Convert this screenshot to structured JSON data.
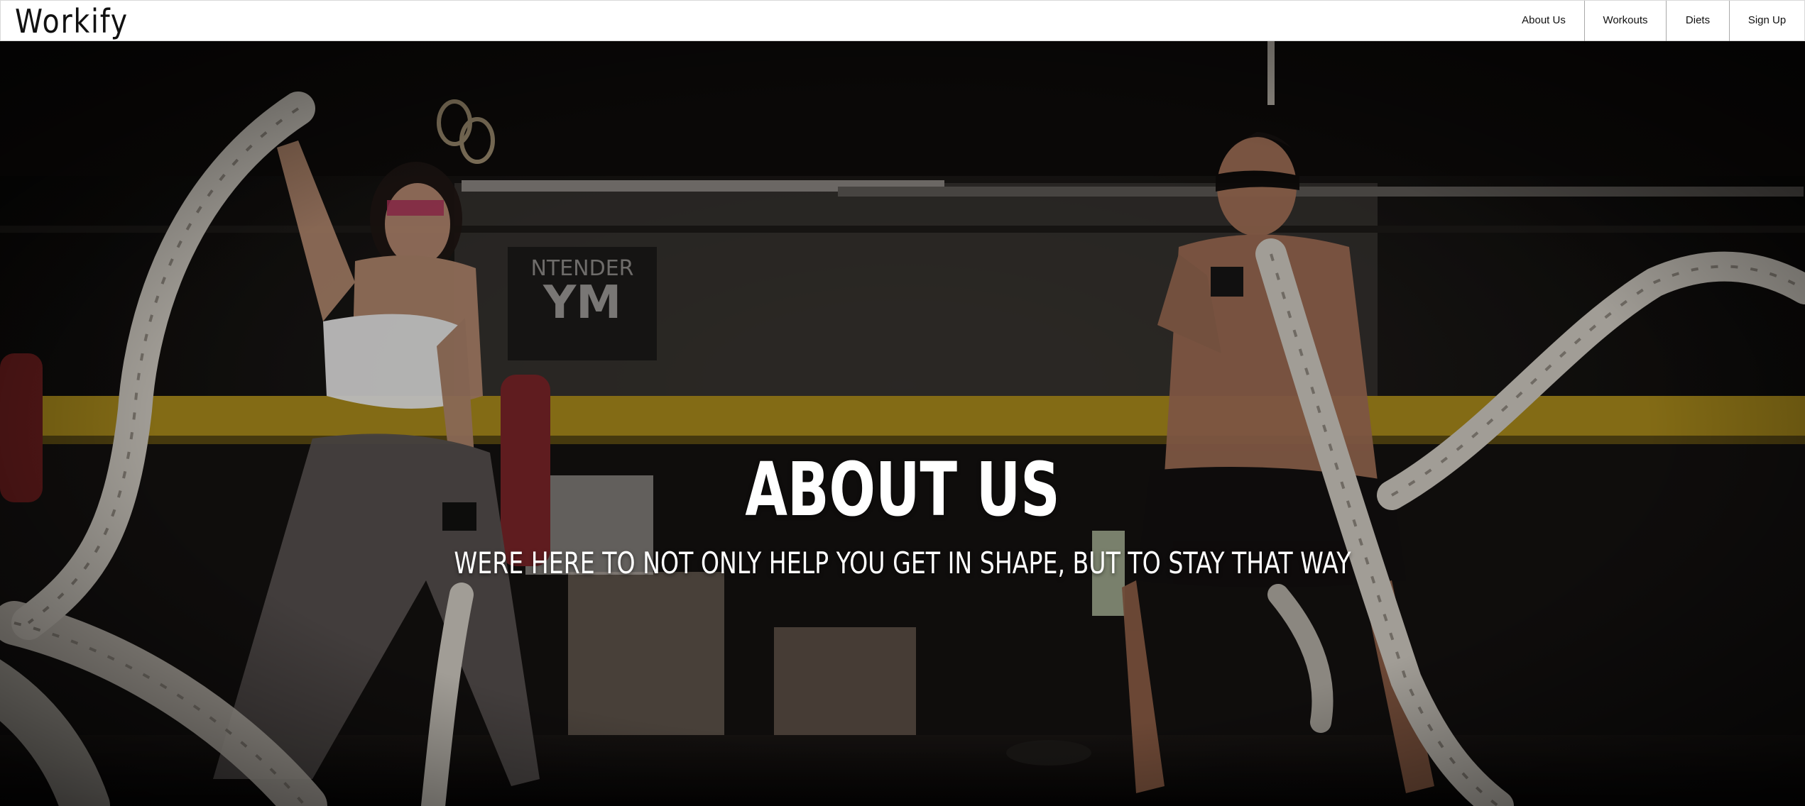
{
  "brand": {
    "name": "Workify"
  },
  "nav": {
    "links": [
      {
        "label": "About Us"
      },
      {
        "label": "Workouts"
      },
      {
        "label": "Diets"
      },
      {
        "label": "Sign Up"
      }
    ]
  },
  "hero": {
    "title": "ABOUT US",
    "subtitle": "WERE HERE TO NOT ONLY HELP YOU GET IN SHAPE, BUT TO STAY THAT WAY",
    "image": {
      "icon": "gym-battle-ropes-photo",
      "colors": {
        "accent_yellow": "#c9a21e",
        "rope": "#cdc7bd",
        "wall": "#3a3632",
        "floor": "#0c0a09"
      }
    }
  }
}
